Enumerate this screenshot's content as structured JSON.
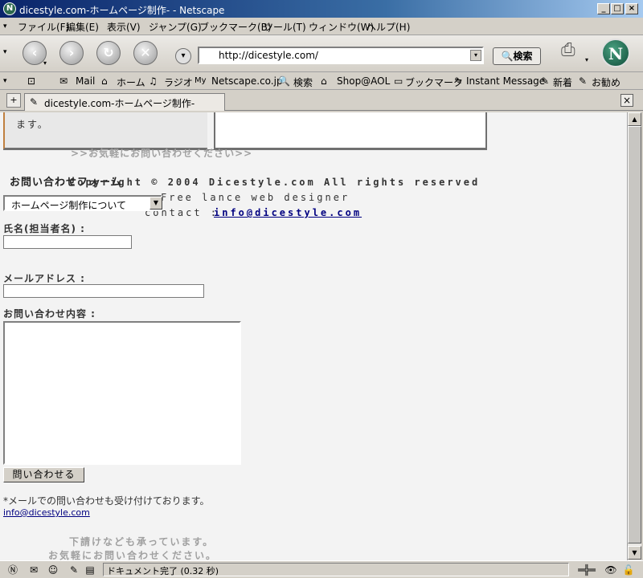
{
  "window": {
    "title": "dicestyle.com-ホームページ制作- - Netscape",
    "logo": "N"
  },
  "menu": [
    "ファイル(F)",
    "編集(E)",
    "表示(V)",
    "ジャンプ(G)",
    "ブックマーク(B)",
    "ツール(T)",
    "ウィンドウ(W)",
    "ヘルプ(H)"
  ],
  "nav": {
    "url": "http://dicestyle.com/",
    "search_label": "検索",
    "brand_logo": "N"
  },
  "personal_toolbar": [
    "Mail",
    "ホーム",
    "ラジオ",
    "Netscape.co.jp",
    "検索",
    "Shop@AOL",
    "ブックマーク",
    "Instant Message",
    "新着",
    "お勧め"
  ],
  "tab": {
    "label": "dicestyle.com-ホームページ制作-"
  },
  "page": {
    "top_text": "ます。",
    "contact_link_banner": ">>お気軽にお問い合わせください>>",
    "form_heading": "お問い合わせフォーム",
    "copyright": "Copyright © 2004 Dicestyle.com All rights reserved",
    "designer": "Free lance web designer",
    "contact_label": "contact :",
    "contact_email": "info@dicestyle.com",
    "select_value": "ホームページ制作について",
    "name_label": "氏名(担当者名) :",
    "name_value": "",
    "email_label": "メールアドレス :",
    "email_value": "",
    "inquiry_label": "お問い合わせ内容 :",
    "inquiry_value": "",
    "submit_label": "問い合わせる",
    "mail_note": "*メールでの問い合わせも受け付けております。",
    "mail_link": "info@dicestyle.com",
    "sub_line1": "下請けなども承っています。",
    "sub_line2": "お気軽にお問い合わせください。"
  },
  "status": {
    "text": "ドキュメント完了 (0.32 秒)"
  },
  "colors": {
    "title_gradient_start": "#0a246a",
    "link": "#000080",
    "banner_text": "#a0a0a0",
    "content_bg": "#f3f3f3"
  },
  "icons": [
    "back-icon",
    "forward-icon",
    "reload-icon",
    "stop-icon",
    "search-icon",
    "mail-icon",
    "home-icon",
    "radio-icon",
    "bookmark-icon",
    "close-tab-icon",
    "lock-icon"
  ]
}
